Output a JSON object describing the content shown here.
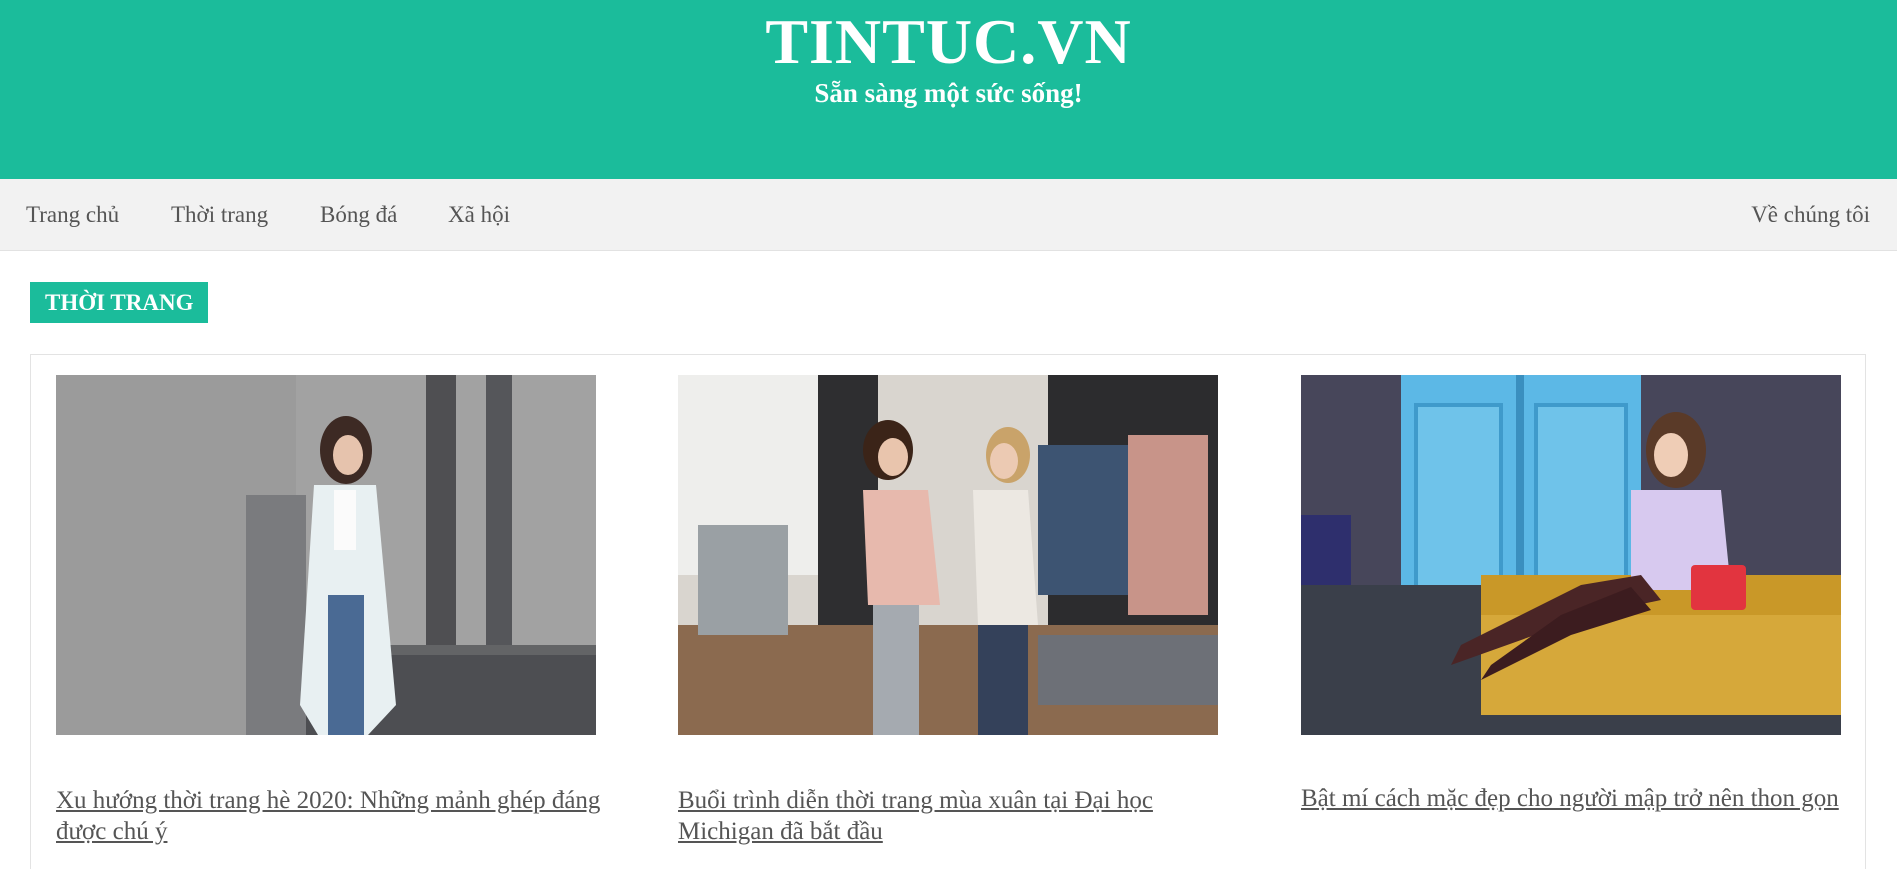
{
  "header": {
    "site_title": "TINTUC.VN",
    "tagline": "Sẵn sàng một sức sống!",
    "background_color": "#1bbc9b"
  },
  "nav": {
    "items": [
      {
        "label": "Trang chủ"
      },
      {
        "label": "Thời trang"
      },
      {
        "label": "Bóng đá"
      },
      {
        "label": "Xã hội"
      }
    ],
    "about_label": "Về chúng tôi"
  },
  "section": {
    "badge": "THỜI TRANG"
  },
  "articles": [
    {
      "title": "Xu hướng thời trang hè 2020: Những mảnh ghép đáng được chú ý"
    },
    {
      "title": "Buổi trình diễn thời trang mùa xuân tại Đại học Michigan đã bắt đầu"
    },
    {
      "title": "Bật mí cách mặc đẹp cho người mập trở nên thon gọn"
    }
  ]
}
